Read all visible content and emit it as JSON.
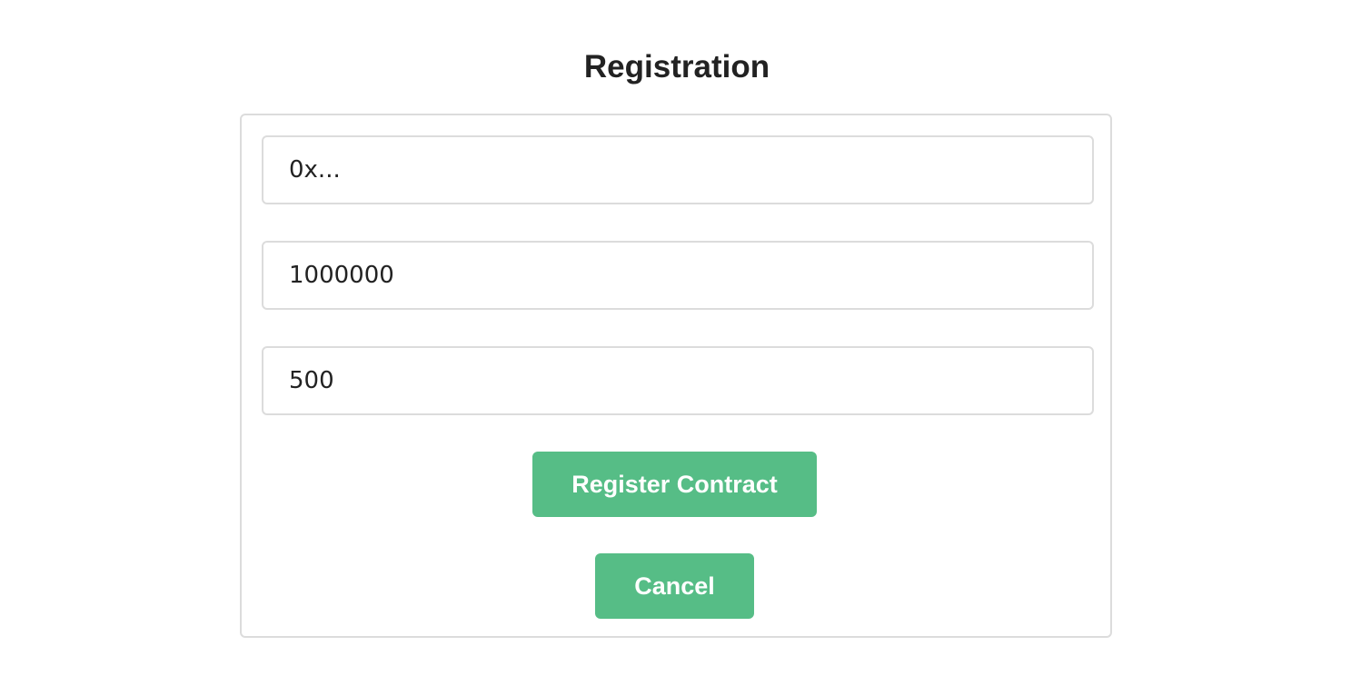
{
  "page": {
    "title": "Registration"
  },
  "form": {
    "address_field": {
      "placeholder": "0x...",
      "value": ""
    },
    "amount_field": {
      "placeholder": "",
      "value": "1000000"
    },
    "third_field": {
      "placeholder": "",
      "value": "500"
    },
    "register_button_label": "Register Contract",
    "cancel_button_label": "Cancel"
  },
  "colors": {
    "button_background": "#56bd86",
    "button_text": "#ffffff",
    "border": "#dcdcdc",
    "text": "#222222"
  }
}
